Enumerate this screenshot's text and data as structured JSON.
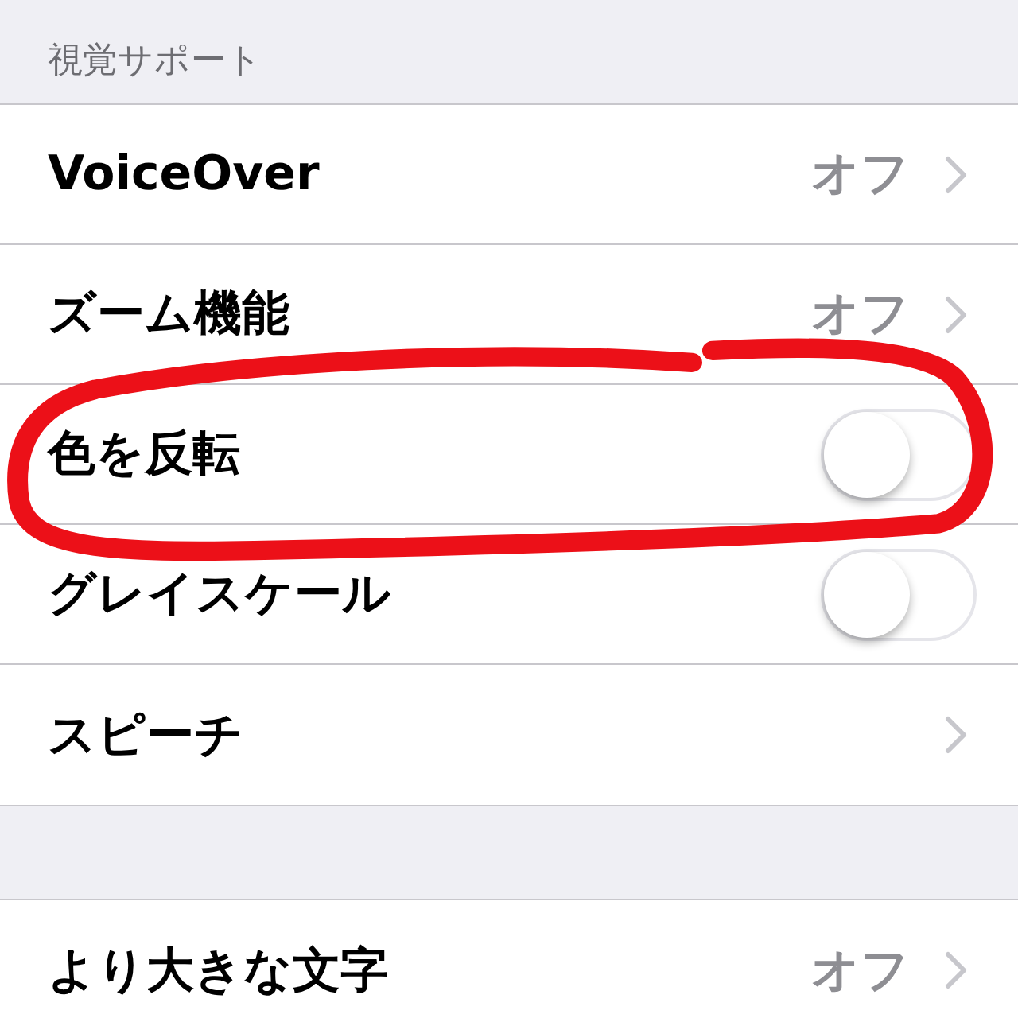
{
  "sections": [
    {
      "header": "視覚サポート",
      "rows": [
        {
          "kind": "link",
          "label": "VoiceOver",
          "value": "オフ",
          "circled": false
        },
        {
          "kind": "link",
          "label": "ズーム機能",
          "value": "オフ",
          "circled": false
        },
        {
          "kind": "toggle",
          "label": "色を反転",
          "on": false,
          "circled": true
        },
        {
          "kind": "toggle",
          "label": "グレイスケール",
          "on": false,
          "circled": false
        },
        {
          "kind": "link",
          "label": "スピーチ",
          "circled": false
        }
      ]
    },
    {
      "rows": [
        {
          "kind": "link",
          "label": "より大きな文字",
          "value": "オフ",
          "circled": false
        }
      ]
    }
  ]
}
